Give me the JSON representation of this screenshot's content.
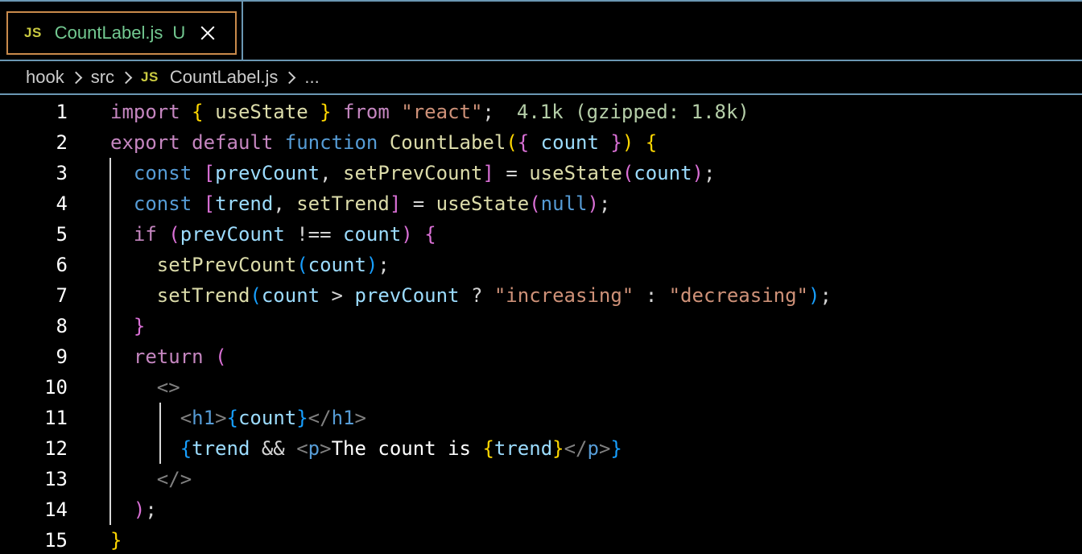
{
  "tab": {
    "icon": "JS",
    "filename": "CountLabel.js",
    "status": "U",
    "close_icon": "close-icon"
  },
  "breadcrumb": {
    "items": [
      "hook",
      "src",
      "CountLabel.js",
      "..."
    ],
    "file_icon": "JS"
  },
  "editor": {
    "line_numbers": [
      "1",
      "2",
      "3",
      "4",
      "5",
      "6",
      "7",
      "8",
      "9",
      "10",
      "11",
      "12",
      "13",
      "14",
      "15"
    ],
    "lines": [
      "import { useState } from \"react\";",
      "export default function CountLabel({ count }) {",
      "  const [prevCount, setPrevCount] = useState(count);",
      "  const [trend, setTrend] = useState(null);",
      "  if (prevCount !== count) {",
      "    setPrevCount(count);",
      "    setTrend(count > prevCount ? \"increasing\" : \"decreasing\");",
      "  }",
      "  return (",
      "    <>",
      "      <h1>{count}</h1>",
      "      {trend && <p>The count is {trend}</p>}",
      "    </>",
      "  );",
      "}"
    ],
    "import_cost_hint": "4.1k (gzipped: 1.8k)"
  },
  "colors": {
    "tab_border": "#c98a4b",
    "untracked_file": "#73c991",
    "js_icon": "#cbcb41",
    "separator": "#6b97b3"
  }
}
